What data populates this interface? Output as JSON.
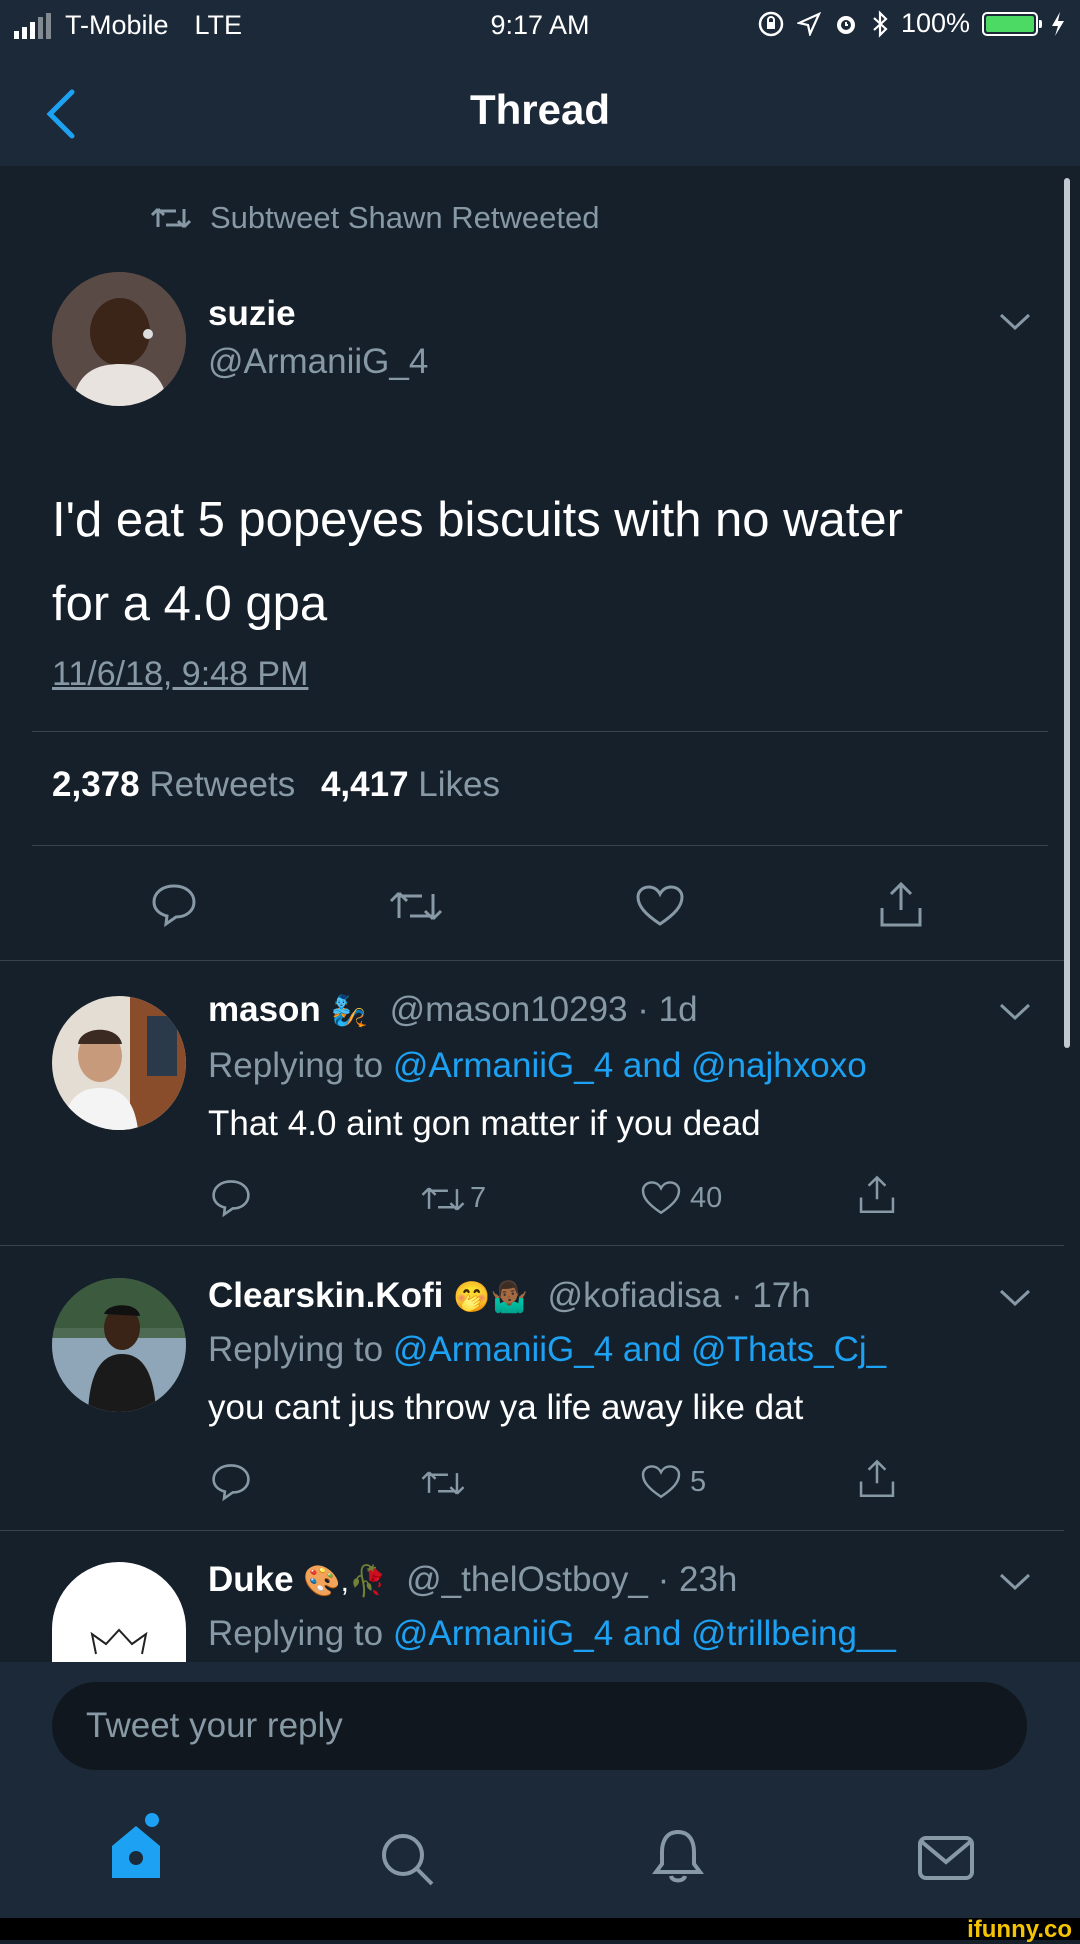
{
  "status_bar": {
    "carrier": "T-Mobile",
    "network": "LTE",
    "time": "9:17 AM",
    "battery": "100%"
  },
  "nav": {
    "title": "Thread"
  },
  "main_tweet": {
    "retweet_label": "Subtweet Shawn Retweeted",
    "name": "suzie",
    "handle": "@ArmaniiG_4",
    "text_line1": "I'd eat 5 popeyes biscuits with no water",
    "text_line2": "for a 4.0 gpa",
    "date": "11/6/18, 9:48 PM",
    "retweets_count": "2,378",
    "retweets_label": "Retweets",
    "likes_count": "4,417",
    "likes_label": "Likes"
  },
  "replies": [
    {
      "name": "mason",
      "emoji": "🧞",
      "handle": "@mason10293",
      "time": "· 1d",
      "replying_prefix": "Replying to",
      "mention1": "@ArmaniiG_4",
      "and": "and",
      "mention2": "@najhxoxo",
      "text": "That 4.0 aint gon matter if you dead",
      "retweets": "7",
      "likes": "40"
    },
    {
      "name": "Clearskin.Kofi",
      "emoji": "🤭🤷🏾‍♂️",
      "handle": "@kofiadisa",
      "time": "· 17h",
      "replying_prefix": "Replying to",
      "mention1": "@ArmaniiG_4",
      "and": "and",
      "mention2": "@Thats_Cj_",
      "text": "you cant jus throw ya life away like dat",
      "retweets": "",
      "likes": "5"
    },
    {
      "name": "Duke",
      "emoji": "🎨,🥀",
      "handle": "@_thelOstboy_",
      "time": "· 23h",
      "replying_prefix": "Replying to",
      "mention1": "@ArmaniiG_4",
      "and": "and",
      "mention2": "@trillbeing__",
      "text": "",
      "retweets": "",
      "likes": ""
    }
  ],
  "compose": {
    "placeholder": "Tweet your reply"
  },
  "tabs": [
    "home-icon",
    "search-icon",
    "notifications-icon",
    "messages-icon"
  ],
  "watermark": "ifunny.co",
  "colors": {
    "background": "#15202b",
    "bar": "#1c2938",
    "accent": "#1da1f2",
    "muted": "#8899a6",
    "divider": "#38444d"
  }
}
